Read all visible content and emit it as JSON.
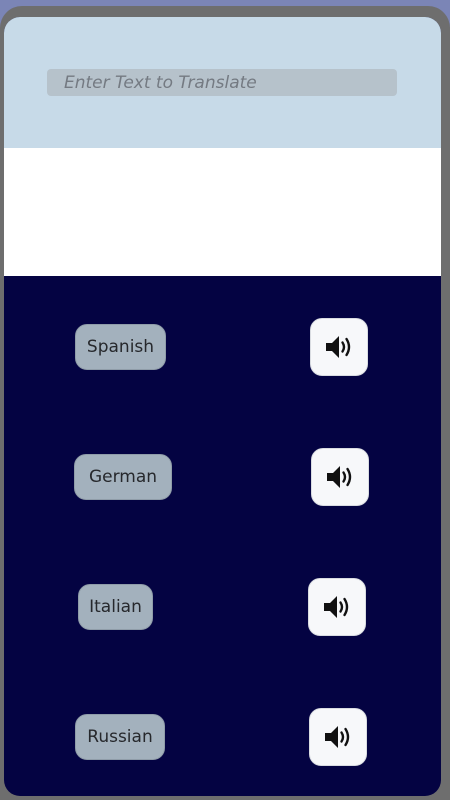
{
  "input": {
    "placeholder": "Enter Text to Translate",
    "value": ""
  },
  "output": {
    "text": ""
  },
  "languages": [
    {
      "label": "Spanish",
      "speaker_icon": "speaker-icon"
    },
    {
      "label": "German",
      "speaker_icon": "speaker-icon"
    },
    {
      "label": "Italian",
      "speaker_icon": "speaker-icon"
    },
    {
      "label": "Russian",
      "speaker_icon": "speaker-icon"
    }
  ],
  "colors": {
    "frame": "#6e6e6e",
    "input_panel": "#c7dae8",
    "input_field": "#b6c2cb",
    "output_panel": "#ffffff",
    "language_panel": "#040342",
    "language_button": "#a3b1bd",
    "speaker_button": "#f7f8fa"
  }
}
